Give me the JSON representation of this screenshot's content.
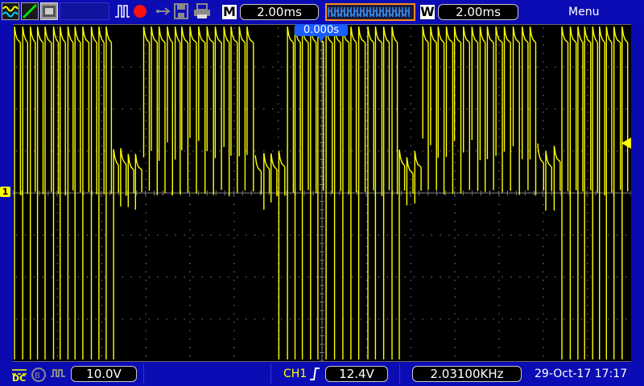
{
  "header": {
    "timebase_tag": "M",
    "timebase_value": "2.00ms",
    "window_tag": "W",
    "window_value": "2.00ms",
    "menu_label": "Menu"
  },
  "trigger_position": "0.000s",
  "channel1_marker": "1",
  "footer": {
    "coupling": "DC",
    "volts_per_div": "10.0V",
    "trigger_source": "CH1",
    "trigger_level": "12.4V",
    "frequency": "2.03100KHz",
    "datetime": "29-Oct-17 17:17"
  },
  "colors": {
    "trace": "#ffff00",
    "grid": "#8a8a8a",
    "accent": "#2060ff",
    "orange": "#ff8a1a"
  },
  "icons": [
    "trace-mode-icon",
    "line-mode-icon",
    "display-mode-icon",
    "pulse-icon",
    "record-icon",
    "usb-icon",
    "save-icon",
    "print-icon"
  ]
}
